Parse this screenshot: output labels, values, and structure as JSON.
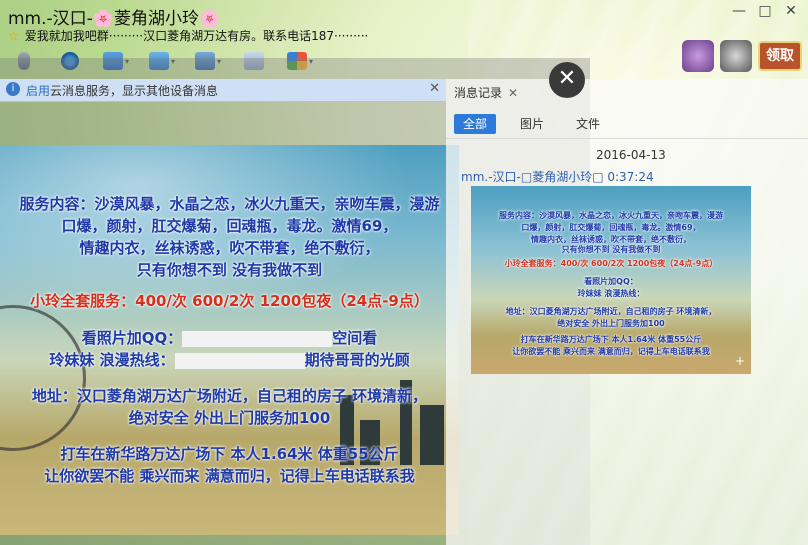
{
  "window": {
    "title_prefix": "mm.-汉口-",
    "title_main": "菱角湖小玲",
    "flower": "🌸",
    "subtitle": "爱我就加我吧群·········汉口菱角湖万达有房。联系电话187·········",
    "controls": {
      "minimize": "—",
      "maximize": "□",
      "close": "✕"
    }
  },
  "toolbar": {
    "icons": [
      "microphone-icon",
      "webcam-icon",
      "screen-share-icon",
      "file-transfer-icon",
      "remote-desktop-icon",
      "message-add-icon",
      "apps-icon"
    ],
    "dropdown_glyph": "▾",
    "game_button_label": "领取"
  },
  "notice": {
    "link": "启用",
    "text": "云消息服务，显示其他设备消息",
    "close": "✕"
  },
  "overlay": {
    "close_glyph": "✕"
  },
  "big_image": {
    "lines": [
      "服务内容：沙漠风暴，水晶之恋，冰火九重天，亲吻车震，漫游",
      "口爆，颜射，肛交爆菊，回魂瓶，毒龙。激情69，",
      "情趣内衣，丝袜诱惑，吹不带套，绝不敷衍，",
      "只有你想不到 没有我做不到",
      "小玲全套服务：400/次  600/2次  1200包夜（24点-9点）",
      "看照片加QQ：",
      "空间看",
      "玲妹妹 浪漫热线：",
      "期待哥哥的光顾",
      "地址：汉口菱角湖万达广场附近，自己租的房子 环境清新，",
      "绝对安全  外出上门服务加100",
      "打车在新华路万达广场下 本人1.64米 体重55公斤",
      "让你欲罢不能 乘兴而来 满意而归，记得上车电话联系我"
    ]
  },
  "message_panel": {
    "tab_title": "消息记录",
    "tab_close": "✕",
    "filter_tabs": [
      "全部",
      "图片",
      "文件"
    ],
    "active_tab": "全部",
    "date": "2016-04-13",
    "sender": "mm.-汉口-□菱角湖小玲□",
    "time": "0:37:24",
    "thumb_plus": "+"
  },
  "colors": {
    "accent_blue": "#2d7bd8",
    "ad_blue_text": "#1f3aa8",
    "ad_red_text": "#d6301c",
    "notice_bg": "#cfe0f5"
  }
}
